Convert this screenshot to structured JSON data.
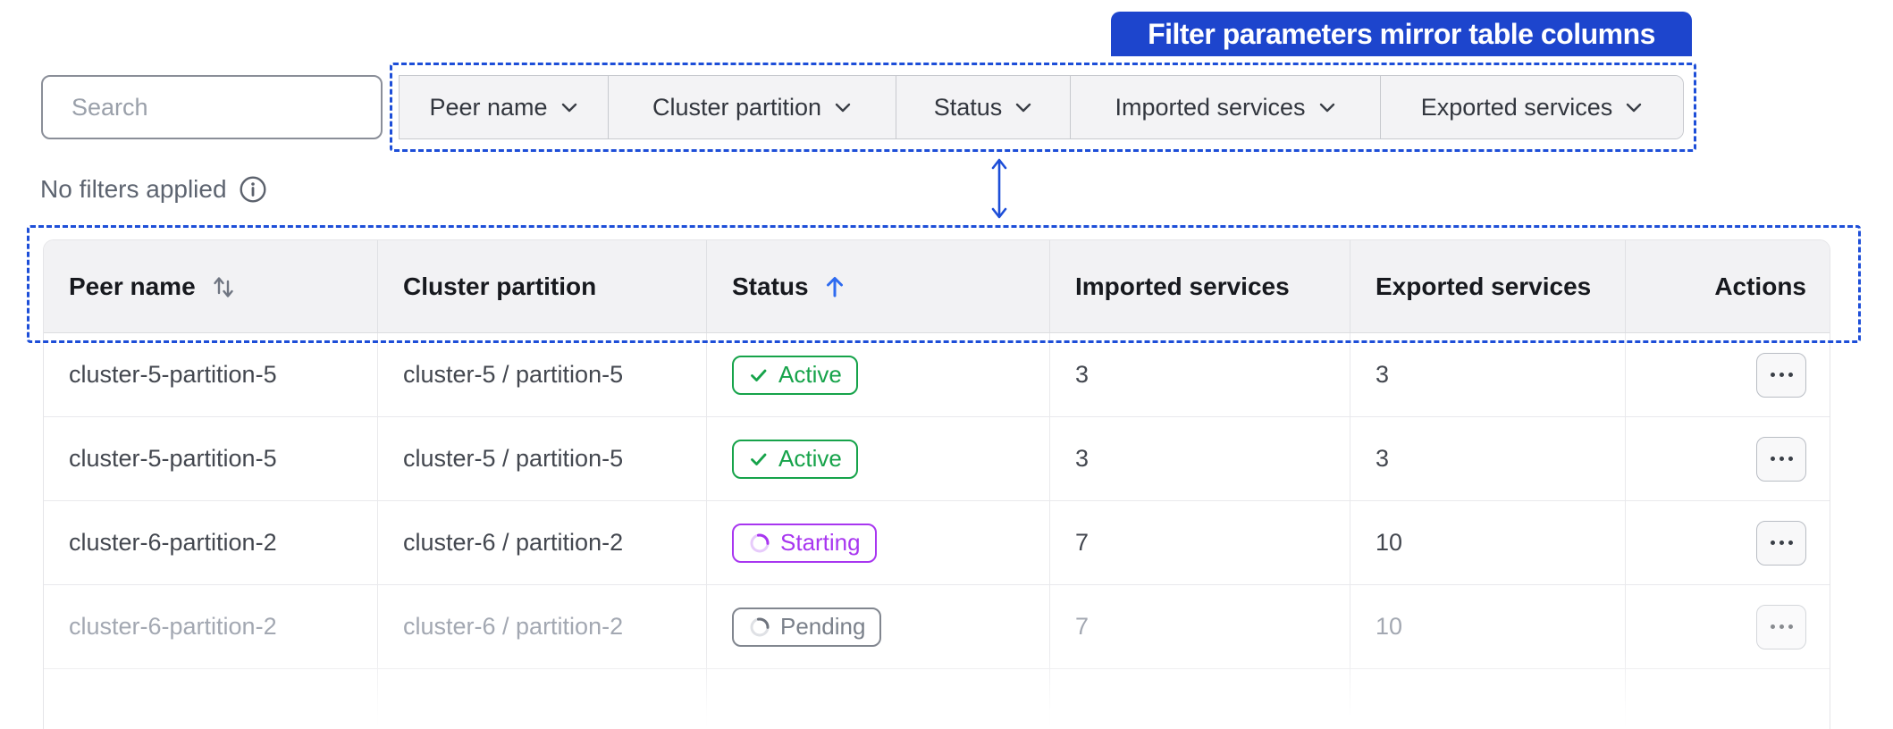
{
  "callout": {
    "label": "Filter parameters mirror table columns"
  },
  "search": {
    "placeholder": "Search"
  },
  "filters": {
    "status_text": "No filters applied",
    "items": [
      {
        "label": "Peer name"
      },
      {
        "label": "Cluster partition"
      },
      {
        "label": "Status"
      },
      {
        "label": "Imported services"
      },
      {
        "label": "Exported services"
      }
    ]
  },
  "table": {
    "columns": [
      {
        "label": "Peer name",
        "sort": "both"
      },
      {
        "label": "Cluster partition",
        "sort": "none"
      },
      {
        "label": "Status",
        "sort": "ascending"
      },
      {
        "label": "Imported services",
        "sort": "none"
      },
      {
        "label": "Exported services",
        "sort": "none"
      },
      {
        "label": "Actions",
        "sort": "none"
      }
    ],
    "rows": [
      {
        "peer_name": "cluster-5-partition-5",
        "cluster_partition": "cluster-5 / partition-5",
        "status": "Active",
        "imported": 3,
        "exported": 3,
        "dimmed": false
      },
      {
        "peer_name": "cluster-5-partition-5",
        "cluster_partition": "cluster-5 / partition-5",
        "status": "Active",
        "imported": 3,
        "exported": 3,
        "dimmed": false
      },
      {
        "peer_name": "cluster-6-partition-2",
        "cluster_partition": "cluster-6 / partition-2",
        "status": "Starting",
        "imported": 7,
        "exported": 10,
        "dimmed": false
      },
      {
        "peer_name": "cluster-6-partition-2",
        "cluster_partition": "cluster-6 / partition-2",
        "status": "Pending",
        "imported": 7,
        "exported": 10,
        "dimmed": true
      }
    ]
  },
  "colors": {
    "banner_blue": "#1d45cd",
    "dash_blue": "#1d4ed8",
    "sort_arrow_blue": "#2e6bf0",
    "active_green": "#16a34a",
    "starting_purple": "#a836f0",
    "pending_gray": "#81868f",
    "header_bg": "#f2f2f4",
    "segment_bg": "#f3f3f5"
  }
}
